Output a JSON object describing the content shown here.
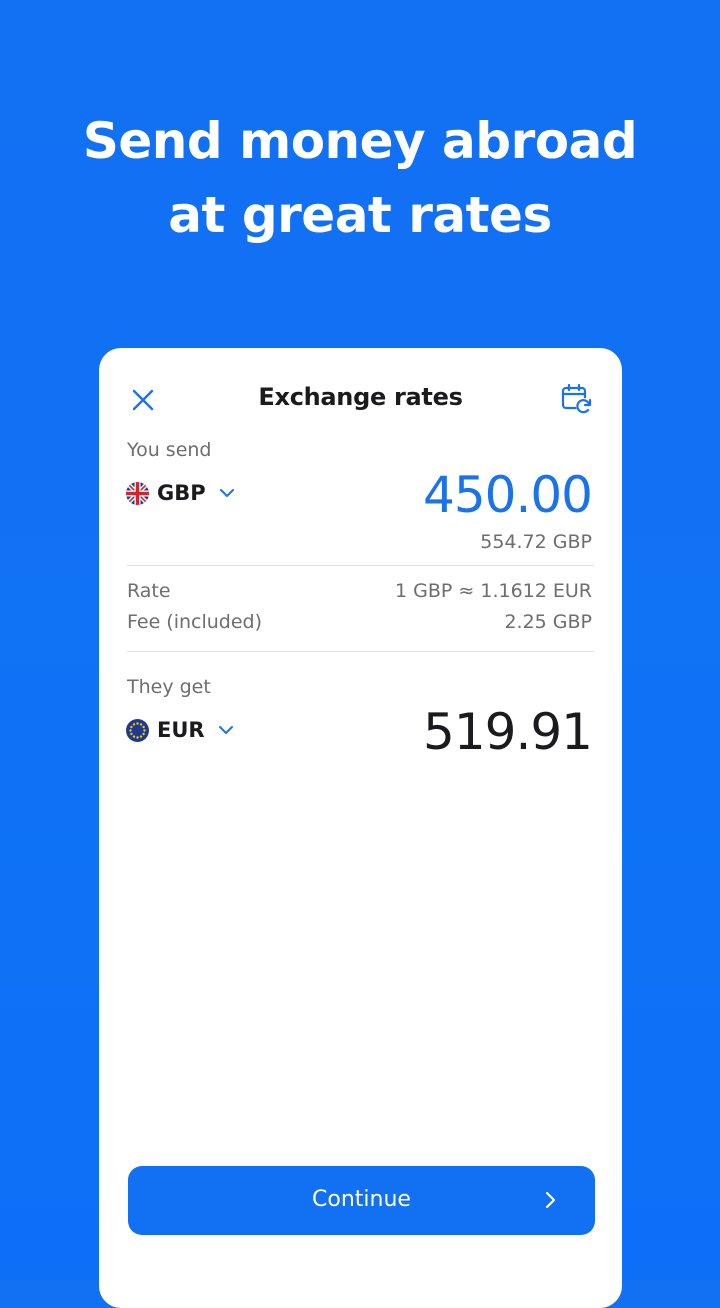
{
  "hero": {
    "line1": "Send money abroad",
    "line2": "at great rates"
  },
  "card": {
    "title": "Exchange rates",
    "close_icon": "close-icon",
    "calendar_icon": "calendar-refresh-icon",
    "send": {
      "label": "You send",
      "currency": "GBP",
      "flag": "uk-flag-icon",
      "amount": "450.00",
      "sub_amount": "554.72 GBP"
    },
    "details": {
      "rate_label": "Rate",
      "rate_value": "1 GBP ≈ 1.1612 EUR",
      "fee_label": "Fee (included)",
      "fee_value": "2.25 GBP"
    },
    "receive": {
      "label": "They get",
      "currency": "EUR",
      "flag": "eu-flag-icon",
      "amount": "519.91"
    },
    "continue_label": "Continue"
  },
  "colors": {
    "background": "#1270f2",
    "accent": "#1a73e8",
    "text": "#1b1b1f",
    "muted": "#6d6d72"
  }
}
